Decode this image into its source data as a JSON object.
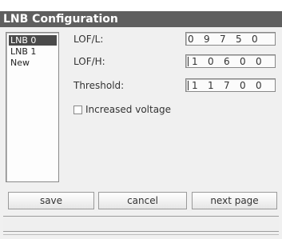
{
  "window": {
    "title": "LNB Configuration"
  },
  "lnb_list": {
    "items": [
      {
        "label": "LNB 0",
        "selected": true
      },
      {
        "label": "LNB 1",
        "selected": false
      },
      {
        "label": "New",
        "selected": false
      }
    ]
  },
  "fields": {
    "lof_l": {
      "label": "LOF/L:",
      "digits": [
        "0",
        "9",
        "7",
        "5",
        "0"
      ]
    },
    "lof_h": {
      "label": "LOF/H:",
      "digits": [
        "1",
        "0",
        "6",
        "0",
        "0"
      ]
    },
    "threshold": {
      "label": "Threshold:",
      "digits": [
        "1",
        "1",
        "7",
        "0",
        "0"
      ]
    }
  },
  "options": {
    "increased_voltage": {
      "label": "Increased voltage",
      "checked": false
    }
  },
  "buttons": {
    "save": "save",
    "cancel": "cancel",
    "next_page": "next page"
  },
  "colors": {
    "titlebar": "#5f5f5f",
    "selection": "#4a4a4a",
    "background": "#f0f0f0"
  }
}
